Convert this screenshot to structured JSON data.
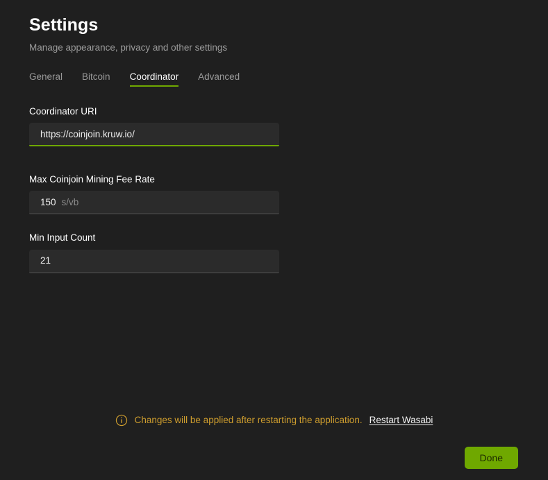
{
  "header": {
    "title": "Settings",
    "subtitle": "Manage appearance, privacy and other settings"
  },
  "tabs": [
    {
      "label": "General",
      "active": false
    },
    {
      "label": "Bitcoin",
      "active": false
    },
    {
      "label": "Coordinator",
      "active": true
    },
    {
      "label": "Advanced",
      "active": false
    }
  ],
  "fields": {
    "coordinator_uri": {
      "label": "Coordinator URI",
      "value": "https://coinjoin.kruw.io/",
      "placeholder": "",
      "focused": true
    },
    "max_mining_fee_rate": {
      "label": "Max Coinjoin Mining Fee Rate",
      "value": "150",
      "suffix": "s/vb",
      "placeholder": "",
      "focused": false
    },
    "min_input_count": {
      "label": "Min Input Count",
      "value": "21",
      "placeholder": "",
      "focused": false
    }
  },
  "footer": {
    "warning_icon": "info-circle-icon",
    "warning_text": "Changes will be applied after restarting the application.",
    "restart_link": "Restart Wasabi",
    "done_label": "Done"
  },
  "colors": {
    "background": "#1f1f1f",
    "field_background": "#2b2b2b",
    "accent_green": "#6fa800",
    "warning_amber": "#cf9e2e",
    "muted_text": "#9a9a9a"
  }
}
